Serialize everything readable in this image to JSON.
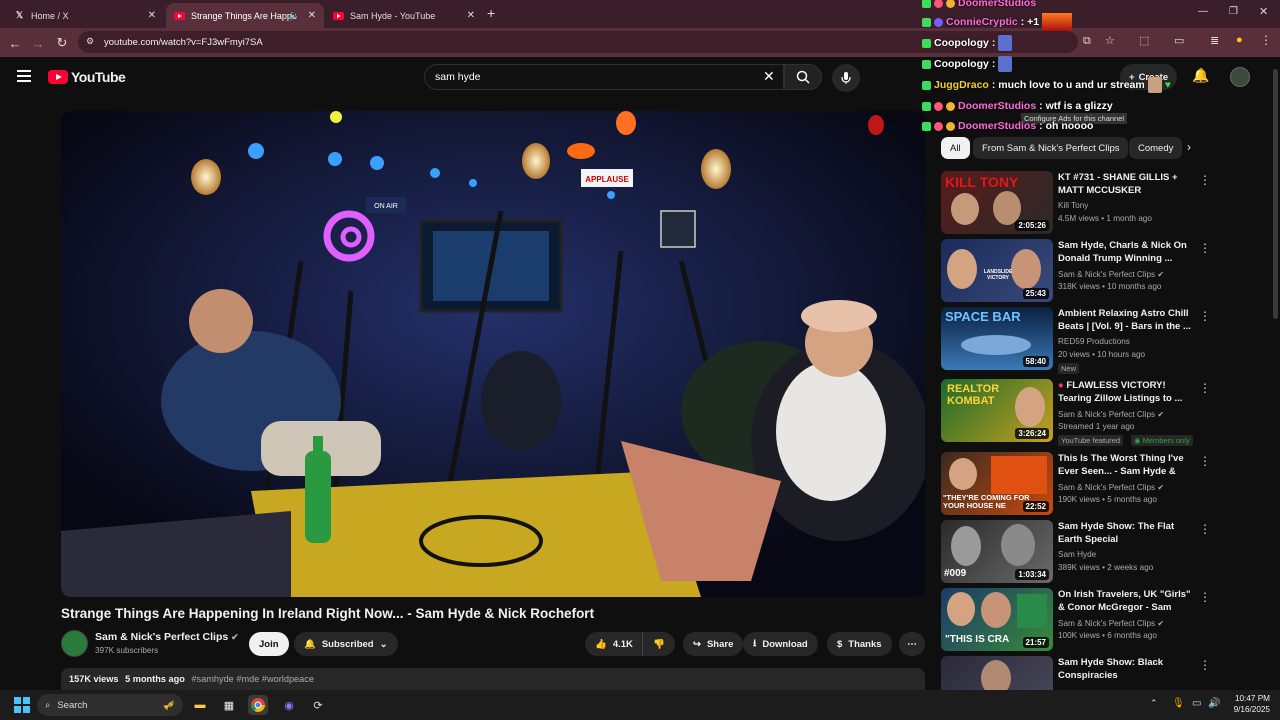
{
  "browser": {
    "tabs": [
      {
        "title": "Home / X",
        "icon": "x-logo-icon"
      },
      {
        "title": "Strange Things Are Happen",
        "icon": "youtube-icon",
        "audio": true
      },
      {
        "title": "Sam Hyde - YouTube",
        "icon": "youtube-icon"
      }
    ],
    "url": "youtube.com/watch?v=FJ3wFmyi7SA"
  },
  "youtube": {
    "logo_text": "YouTube",
    "search_value": "sam hyde",
    "create_label": "Create"
  },
  "video": {
    "title": "Strange Things Are Happening In Ireland Right Now... - Sam Hyde & Nick Rochefort",
    "channel": "Sam & Nick's Perfect Clips",
    "subscribers": "397K subscribers",
    "join_label": "Join",
    "subscribed_label": "Subscribed",
    "likes": "4.1K",
    "share_label": "Share",
    "download_label": "Download",
    "thanks_label": "Thanks",
    "views": "157K views",
    "age": "5 months ago",
    "tags": "#samhyde #mde #worldpeace",
    "scene_sign_1": "APPLAUSE",
    "scene_sign_2": "ON AIR"
  },
  "chips": [
    "All",
    "From Sam & Nick's Perfect Clips",
    "Comedy"
  ],
  "recommendations": [
    {
      "title": "KT #731 - SHANE GILLIS + MATT MCCUSKER",
      "channel": "Kill Tony",
      "meta": "4.5M views • 1 month ago",
      "duration": "2:05:26",
      "thumb_text": "KILL TONY",
      "verified": false
    },
    {
      "title": "Sam Hyde, Charls & Nick On Donald Trump Winning ...",
      "channel": "Sam & Nick's Perfect Clips",
      "meta": "318K views • 10 months ago",
      "duration": "25:43",
      "thumb_text": "LANDSLIDE VICTORY",
      "verified": true
    },
    {
      "title": "Ambient Relaxing Astro Chill Beats | [Vol. 9] - Bars in the ...",
      "channel": "RED59 Productions",
      "meta": "20 views • 10 hours ago",
      "duration": "58:40",
      "thumb_text": "SPACE BAR",
      "badge": "New",
      "verified": false
    },
    {
      "title": "FLAWLESS VICTORY! Tearing Zillow Listings to ...",
      "channel": "Sam & Nick's Perfect Clips",
      "meta": "Streamed 1 year ago",
      "duration": "3:26:24",
      "thumb_text": "REALTOR KOMBAT",
      "badge": "YouTube featured",
      "badge2": "Members only",
      "verified": true
    },
    {
      "title": "This Is The Worst Thing I've Ever Seen... - Sam Hyde & Nic...",
      "channel": "Sam & Nick's Perfect Clips",
      "meta": "190K views • 5 months ago",
      "duration": "22:52",
      "thumb_text": "\"THEY'RE COMING FOR YOUR HOUSE NE",
      "verified": true
    },
    {
      "title": "Sam Hyde Show: The Flat Earth Special",
      "channel": "Sam Hyde",
      "meta": "389K views • 2 weeks ago",
      "duration": "1:03:34",
      "thumb_text": "#009",
      "verified": false
    },
    {
      "title": "On Irish Travelers, UK \"Girls\" & Conor McGregor - Sam Hyde, ...",
      "channel": "Sam & Nick's Perfect Clips",
      "meta": "100K views • 6 months ago",
      "duration": "21:57",
      "thumb_text": "\"THIS IS CRA",
      "verified": true
    },
    {
      "title": "Sam Hyde Show: Black Conspiracies",
      "channel": "",
      "meta": "",
      "duration": "",
      "thumb_text": "",
      "verified": false
    }
  ],
  "chat": [
    {
      "user": "DoomerStudios",
      "msg": ""
    },
    {
      "user": "ConnieCryptic",
      "msg": ": +1"
    },
    {
      "user": "Coopology",
      "msg": ":"
    },
    {
      "user": "Coopology",
      "msg": ":"
    },
    {
      "user": "JuggDraco",
      "msg": ": much love to u and ur stream"
    },
    {
      "user": "DoomerStudios",
      "msg": ": wtf is a glizzy"
    },
    {
      "user": "DoomerStudios",
      "msg": ": oh noooo"
    }
  ],
  "tooltip": "Configure Ads for this channel",
  "taskbar": {
    "search_label": "Search",
    "time": "10:47 PM",
    "date": "9/16/2025"
  },
  "colors": {
    "tab_bar": "#3a1f2a",
    "address_bar": "#5a2f3c",
    "yt_red": "#ff0033",
    "chat_green": "#3ddc5a",
    "chat_pink": "#ff6ad5"
  }
}
